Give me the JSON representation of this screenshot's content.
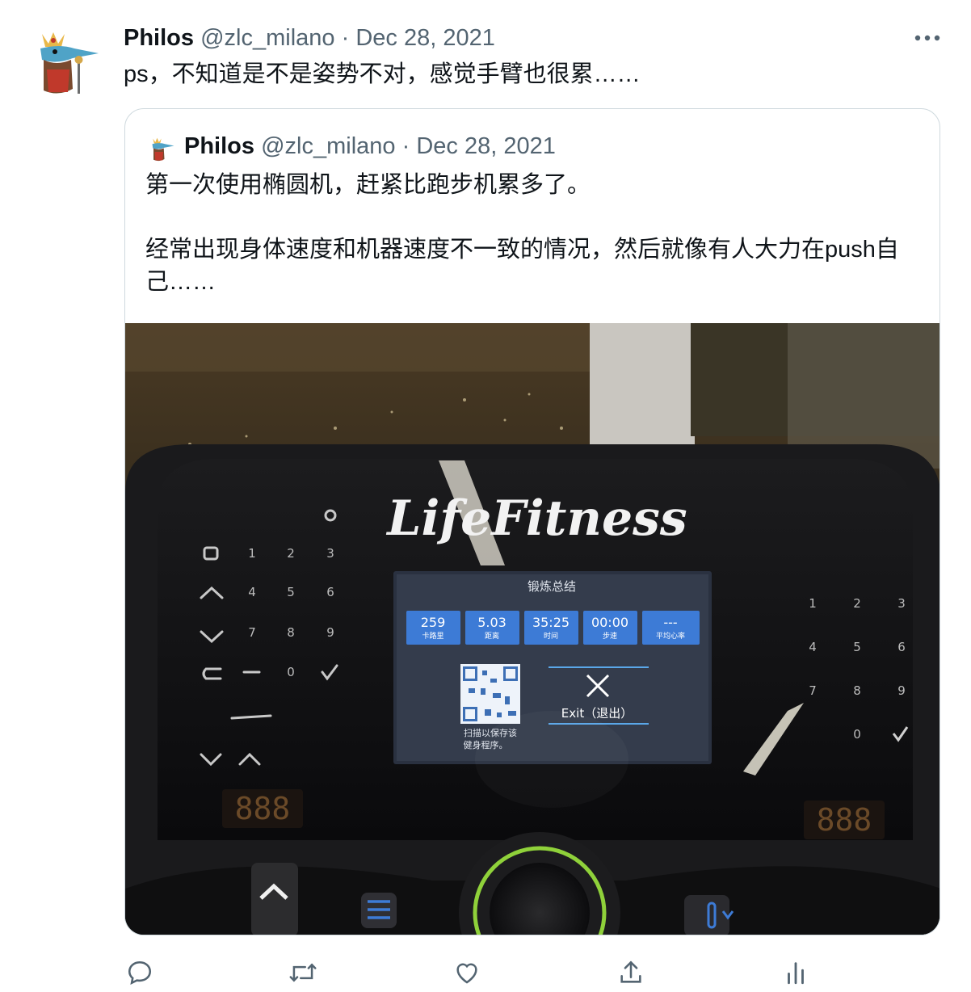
{
  "tweet": {
    "author_name": "Philos",
    "author_handle": "@zlc_milano",
    "separator": "·",
    "date": "Dec 28, 2021",
    "text": "ps，不知道是不是姿势不对，感觉手臂也很累……"
  },
  "quoted_tweet": {
    "author_name": "Philos",
    "author_handle": "@zlc_milano",
    "separator": "·",
    "date": "Dec 28, 2021",
    "paragraphs": [
      "第一次使用椭圆机，赶紧比跑步机累多了。",
      "经常出现身体速度和机器速度不一致的情况，然后就像有人大力在push自己……"
    ]
  },
  "console": {
    "brand": "LifeFitness",
    "keypad_left": [
      "1",
      "2",
      "3",
      "4",
      "5",
      "6",
      "7",
      "8",
      "9",
      "0"
    ],
    "keypad_right": [
      "1",
      "2",
      "3",
      "4",
      "5",
      "6",
      "7",
      "8",
      "9",
      "0"
    ],
    "seg_display_left": "888",
    "seg_display_right": "888",
    "screen": {
      "title": "锻炼总结",
      "stats": [
        {
          "value": "259",
          "label": "卡路里"
        },
        {
          "value": "5.03",
          "label": "距离"
        },
        {
          "value": "35:25",
          "label": "时间"
        },
        {
          "value": "00:00",
          "label": "步速"
        },
        {
          "value": "---",
          "label": "平均心率"
        }
      ],
      "qr_caption_1": "扫描以保存该",
      "qr_caption_2": "健身程序。",
      "exit_label": "Exit（退出）"
    }
  },
  "actions": {
    "icons": [
      "reply-icon",
      "retweet-icon",
      "like-icon",
      "share-icon",
      "analytics-icon"
    ]
  },
  "colors": {
    "text_primary": "#0f1419",
    "text_secondary": "#536471",
    "border": "#cfd9de",
    "screen_tile": "#3d7bd6"
  }
}
